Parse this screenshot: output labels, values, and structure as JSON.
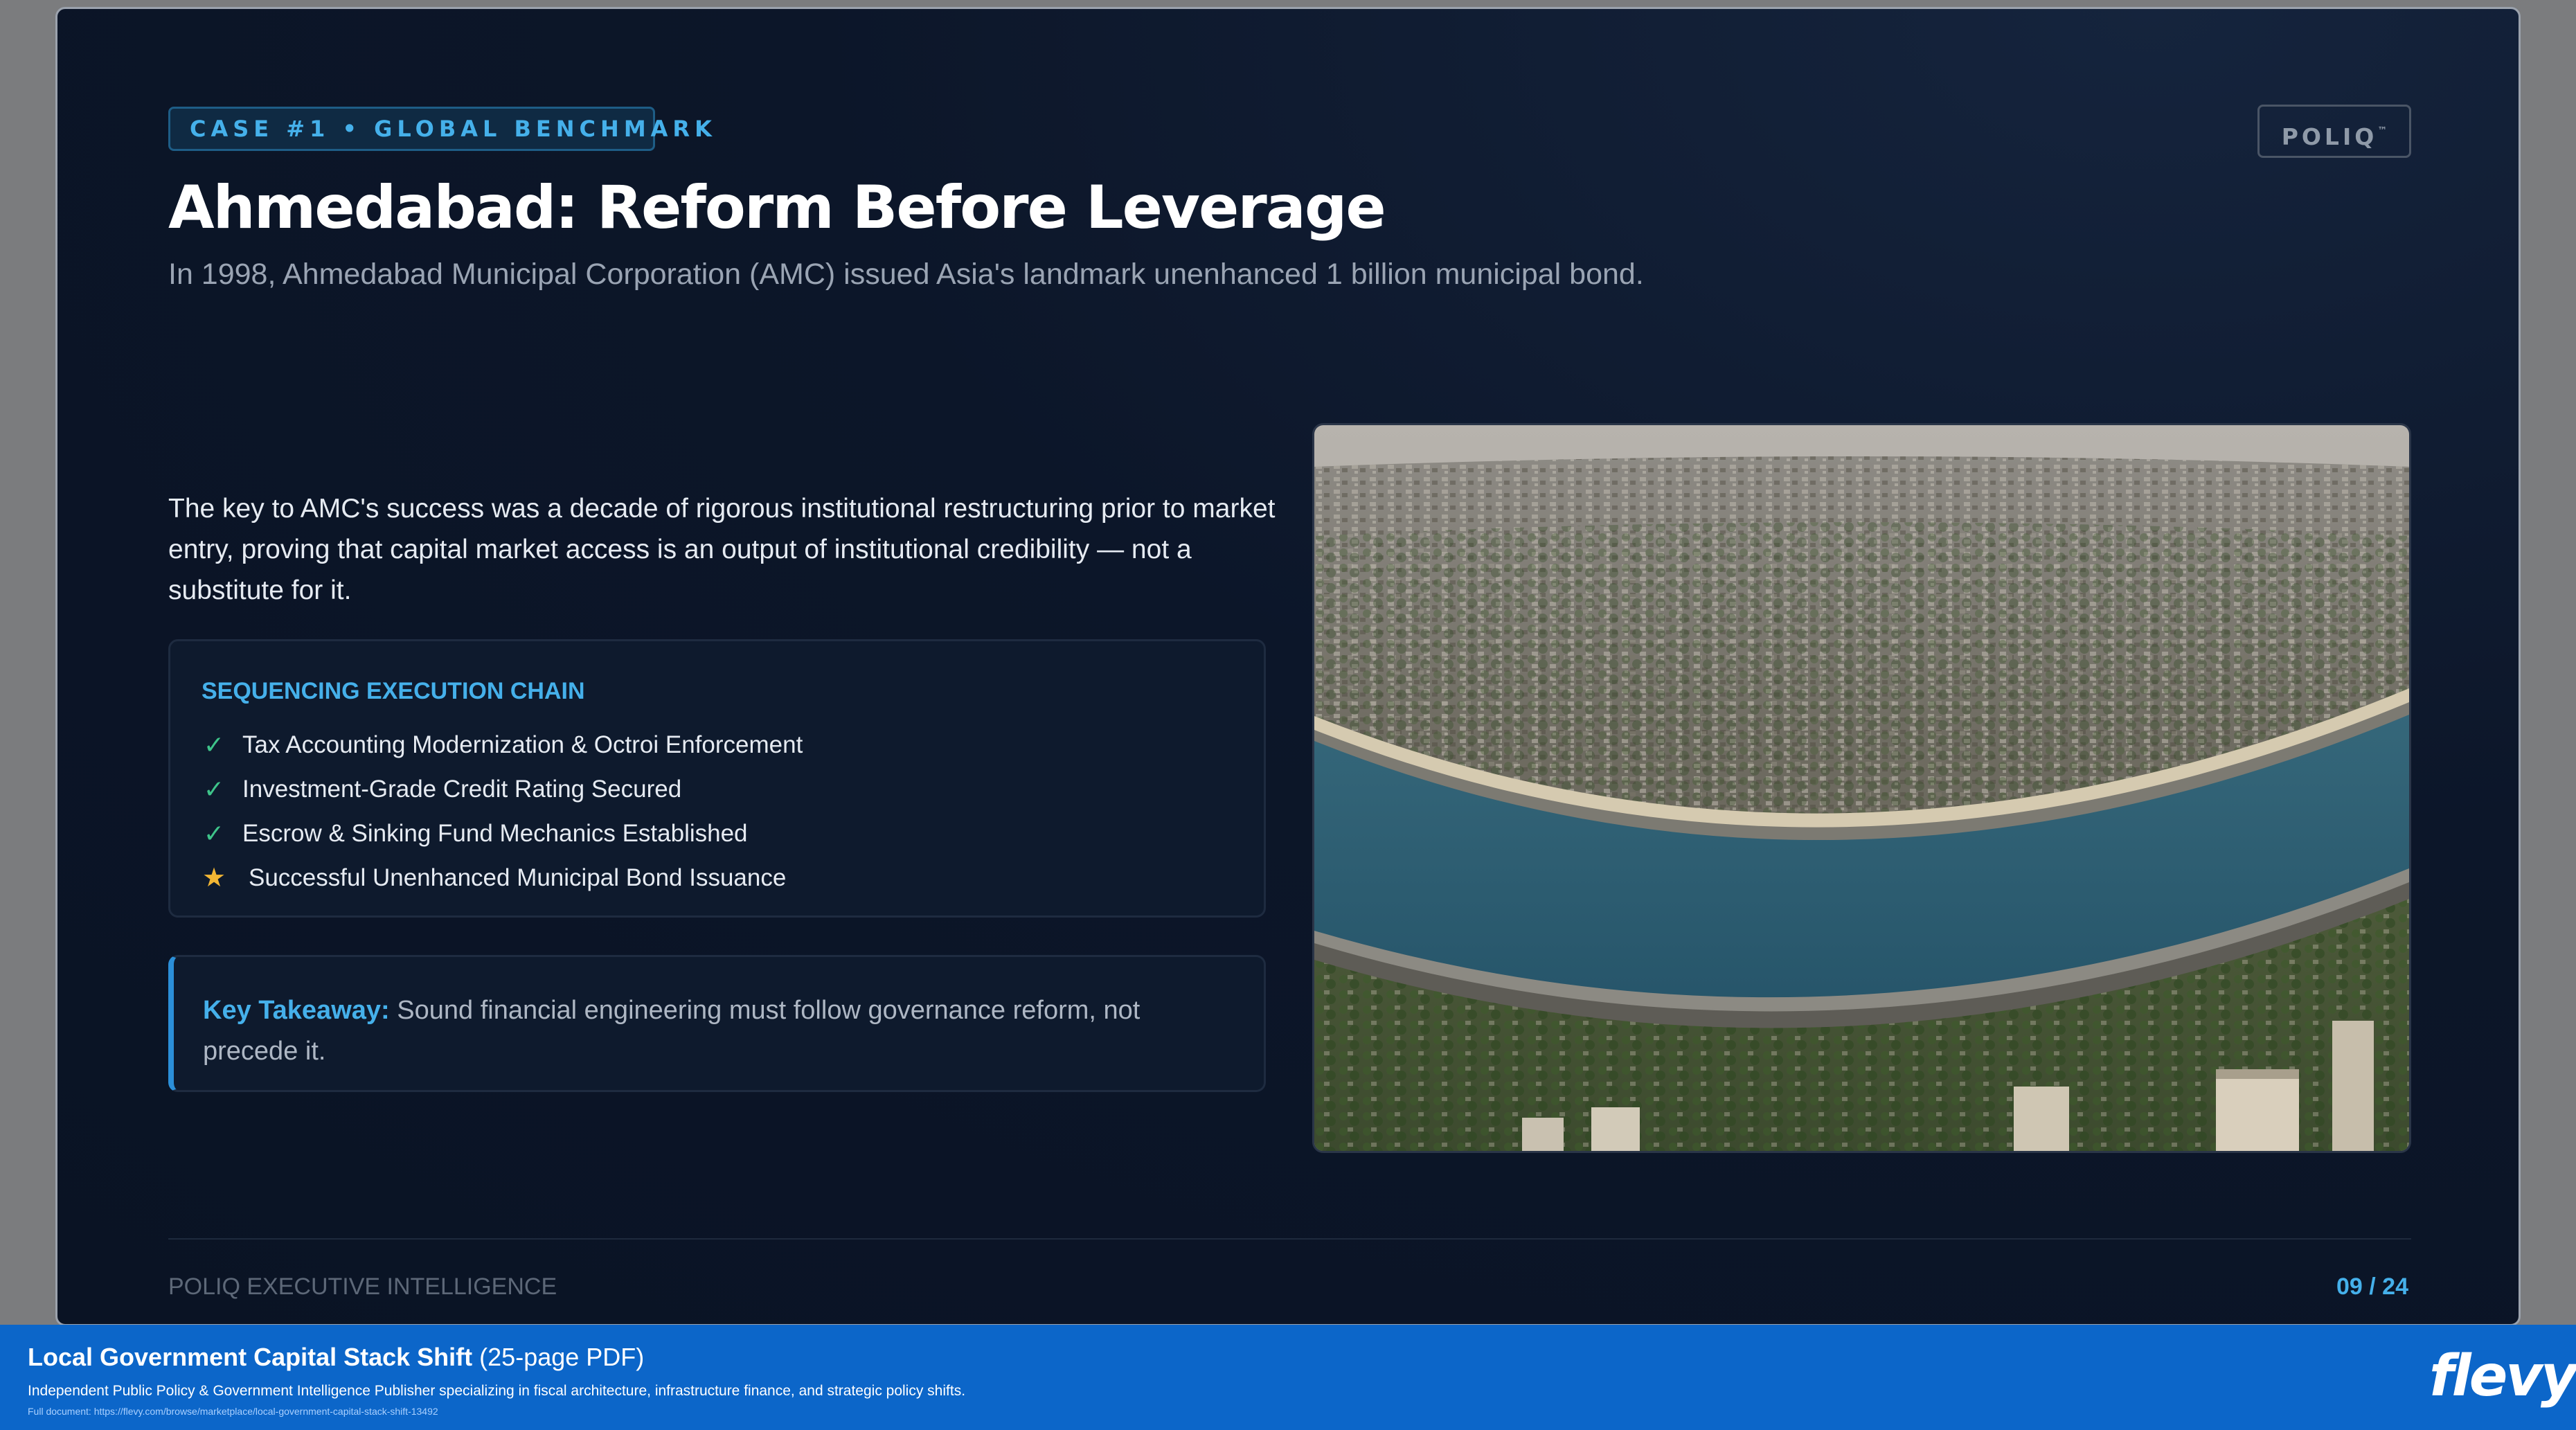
{
  "slide": {
    "case_tag": "CASE #1 • GLOBAL BENCHMARK",
    "brand": "POLIQ",
    "brand_tm": "™",
    "title": "Ahmedabad: Reform Before Leverage",
    "subtitle": "In 1998, Ahmedabad Municipal Corporation (AMC) issued Asia's landmark unenhanced 1 billion municipal bond.",
    "intro": "The key to AMC's success was a decade of rigorous institutional restructuring prior to market entry, proving that capital market access is an output of institutional credibility — not a substitute for it.",
    "chain": {
      "title": "SEQUENCING EXECUTION CHAIN",
      "items": [
        {
          "label": "Tax Accounting Modernization & Octroi Enforcement",
          "icon": "check-icon"
        },
        {
          "label": "Investment-Grade Credit Rating Secured",
          "icon": "check-icon"
        },
        {
          "label": "Escrow & Sinking Fund Mechanics Established",
          "icon": "check-icon"
        },
        {
          "label": "Successful Unenhanced Municipal Bond Issuance",
          "icon": "star-icon"
        }
      ]
    },
    "takeaway": {
      "label": "Key Takeaway:",
      "text": "Sound financial engineering must follow governance reform, not precede it."
    },
    "photo": {
      "icon": "aerial-city-river-photo"
    },
    "footer": {
      "left": "POLIQ EXECUTIVE INTELLIGENCE",
      "page": "09 / 24"
    }
  },
  "banner": {
    "title": "Local Government Capital Stack Shift",
    "pages": "(25-page PDF)",
    "description": "Independent Public Policy & Government Intelligence Publisher specializing in fiscal architecture, infrastructure finance, and strategic policy shifts.",
    "url": "Full document: https://flevy.com/browse/marketplace/local-government-capital-stack-shift-13492",
    "logo": "flevy"
  },
  "colors": {
    "slide_bg": "#0c1629",
    "accent": "#45b0ea",
    "check": "#3ec48a",
    "star": "#f2b634",
    "banner_bg": "#0c66c9"
  }
}
